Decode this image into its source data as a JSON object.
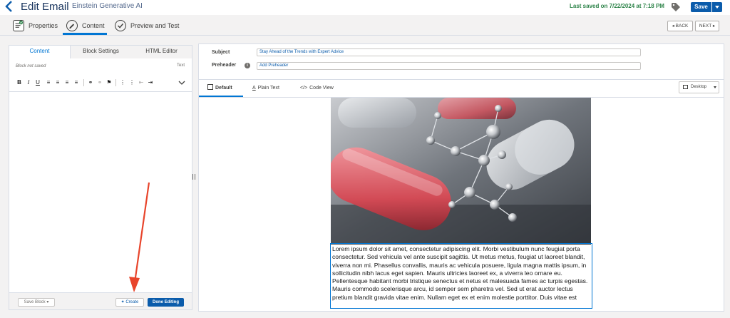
{
  "header": {
    "title": "Edit Email",
    "subtitle": "Einstein Generative AI",
    "last_saved": "Last saved on 7/22/2024 at 7:18 PM",
    "save_label": "Save"
  },
  "tabs": [
    {
      "label": "Properties"
    },
    {
      "label": "Content"
    },
    {
      "label": "Preview and Test"
    }
  ],
  "nav": {
    "back": "◂ BACK",
    "next": "NEXT ▸"
  },
  "left_panel": {
    "tabs": [
      "Content",
      "Block Settings",
      "HTML Editor"
    ],
    "block_status": "Block not saved",
    "text_label": "Text",
    "save_block": "Save Block ▾",
    "create": "Create",
    "done_editing": "Done Editing"
  },
  "email": {
    "subject_label": "Subject",
    "subject_value": "Stay Ahead of the Trends with Expert Advice",
    "preheader_label": "Preheader",
    "preheader_placeholder": "Add Preheader",
    "view_tabs": [
      "Default",
      "Plain Text",
      "Code View"
    ],
    "device": "Desktop",
    "body_text": "Lorem ipsum dolor sit amet, consectetur adipiscing elit. Morbi vestibulum nunc feugiat porta consectetur. Sed vehicula vel ante suscipit sagittis. Ut metus metus, feugiat ut laoreet blandit, viverra non mi. Phasellus convallis, mauris ac vehicula posuere, ligula magna mattis ipsum, in sollicitudin nibh lacus eget sapien. Mauris ultricies laoreet ex, a viverra leo ornare eu. Pellentesque habitant morbi tristique senectus et netus et malesuada fames ac turpis egestas. Mauris commodo scelerisque arcu, id semper sem pharetra vel. Sed ut erat auctor lectus pretium blandit gravida vitae enim. Nullam eget ex et enim molestie porttitor. Duis vitae est"
  },
  "colors": {
    "brand_blue": "#0b5cab",
    "saved_green": "#2e844a",
    "annotation_red": "#e8452c"
  }
}
